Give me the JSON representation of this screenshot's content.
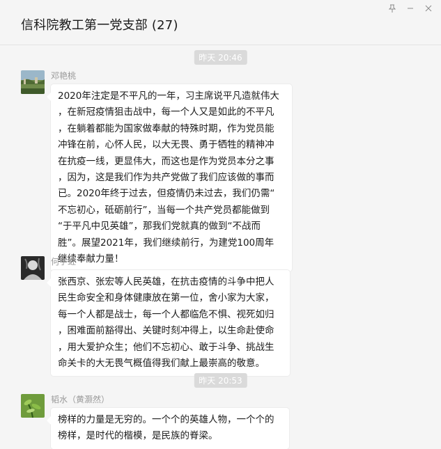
{
  "window": {
    "title": "信科院教工第一党支部 (27)",
    "pin_icon": "pin-icon",
    "minimize_icon": "minimize-icon",
    "close_icon": "close-icon"
  },
  "timestamps": [
    "昨天 20:46",
    "昨天 20:53"
  ],
  "messages": [
    {
      "sender": "邓艳桃",
      "avatar": "landscape-avatar",
      "lines": [
        "2020年注定是不平凡的一年，习主席说平凡造就伟大",
        "，在新冠疫情狙击战中，每一个人又是如此的不平凡",
        "，在躺着都能为国家做奉献的特殊时期，作为党员能",
        "冲锋在前，心怀人民，以大无畏、勇于牺牲的精神冲",
        "在抗疫一线，更显伟大，而这也是作为党员本分之事",
        "，因为，这是我们作为共产党做了我们应该做的事而",
        "已。2020年终于过去，但疫情仍未过去，我们仍需“",
        "不忘初心，砥砺前行”，当每一个共产党员都能做到",
        "“于平凡中见英雄”，那我们党就真的做到“不战而",
        "胜”。展望2021年，我们继续前行，为建党100周年",
        "继续奉献力量！"
      ]
    },
    {
      "sender": "何宇虹",
      "avatar": "portrait-avatar",
      "lines": [
        "张西京、张宏等人民英雄，在抗击疫情的斗争中把人",
        "民生命安全和身体健康放在第一位，舍小家为大家，",
        "每一个人都是战士，每一个人都临危不惧、视死如归",
        "，困难面前豁得出、关键时刻冲得上，以生命赴使命",
        "，用大爱护众生；他们不忘初心、敢于斗争、挑战生",
        "命关卡的大无畏气概值得我们献上最崇高的敬意。"
      ]
    },
    {
      "sender": "韬水（黄灏然）",
      "avatar": "plant-avatar",
      "lines": [
        "榜样的力量是无穷的。一个个的英雄人物，一个个的",
        "榜样，是时代的楷模，是民族的脊梁。"
      ]
    }
  ]
}
